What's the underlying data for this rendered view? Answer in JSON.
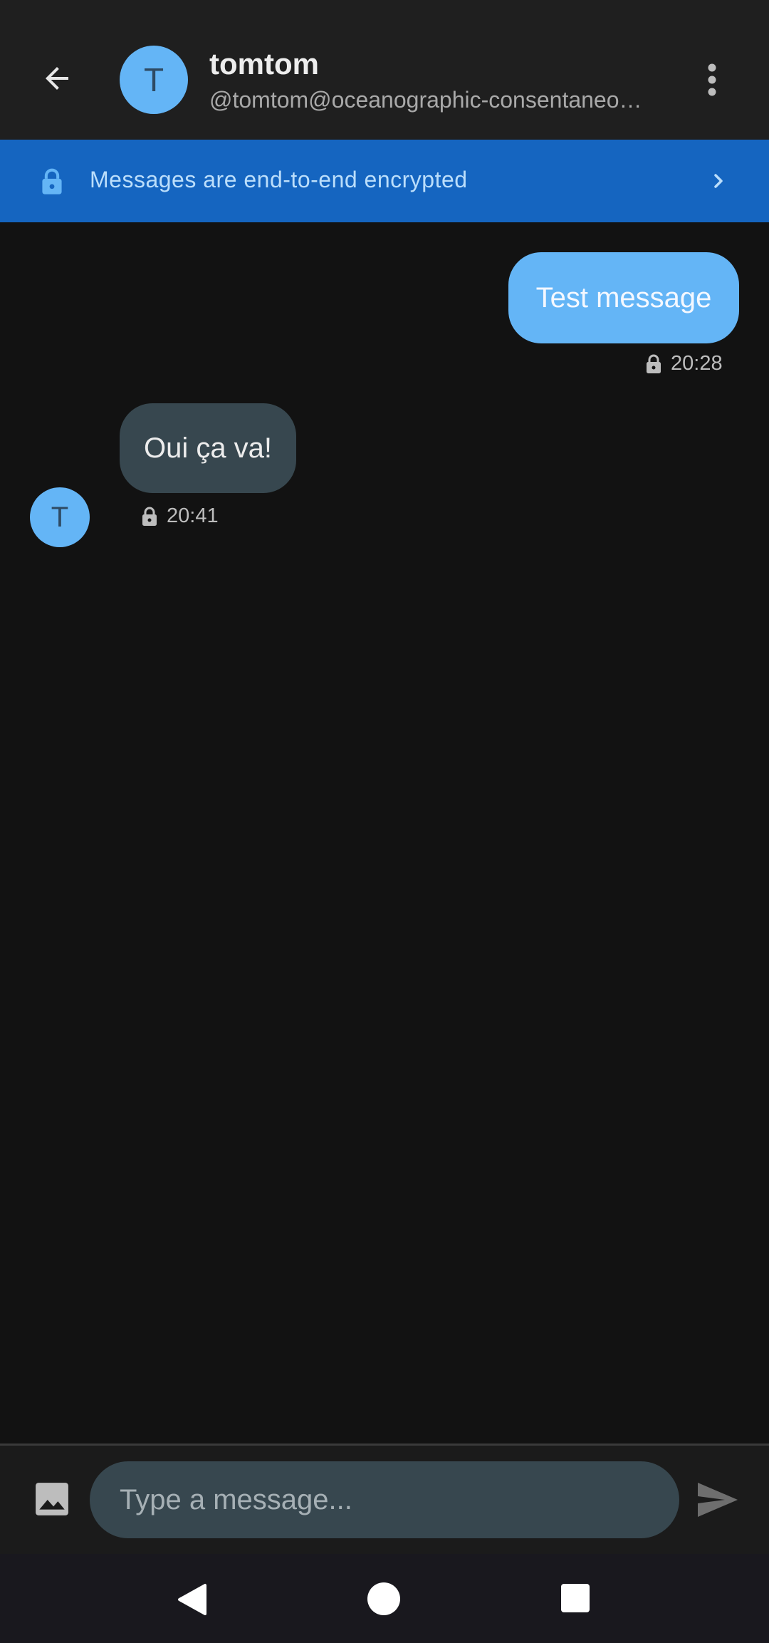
{
  "header": {
    "avatar_letter": "T",
    "name": "tomtom",
    "handle": "@tomtom@oceanographic-consentaneo…",
    "back_icon": "arrow-left-icon",
    "more_icon": "more-vertical-icon"
  },
  "banner": {
    "text": "Messages are end-to-end encrypted",
    "lock_icon": "lock-icon",
    "chevron_icon": "chevron-right-icon",
    "color": "#1565c0"
  },
  "messages": [
    {
      "direction": "outgoing",
      "text": "Test message",
      "time": "20:28",
      "bubble_color": "#64b5f6"
    },
    {
      "direction": "incoming",
      "text": "Oui ça va!",
      "time": "20:41",
      "avatar_letter": "T",
      "bubble_color": "#37474f"
    }
  ],
  "composer": {
    "placeholder": "Type a message...",
    "value": "",
    "image_icon": "image-icon",
    "send_icon": "send-icon"
  },
  "navbar": {
    "back_icon": "nav-back-icon",
    "home_icon": "nav-home-icon",
    "recents_icon": "nav-recents-icon"
  },
  "colors": {
    "background": "#121212",
    "appbar": "#1f1f1f",
    "accent": "#64b5f6"
  }
}
